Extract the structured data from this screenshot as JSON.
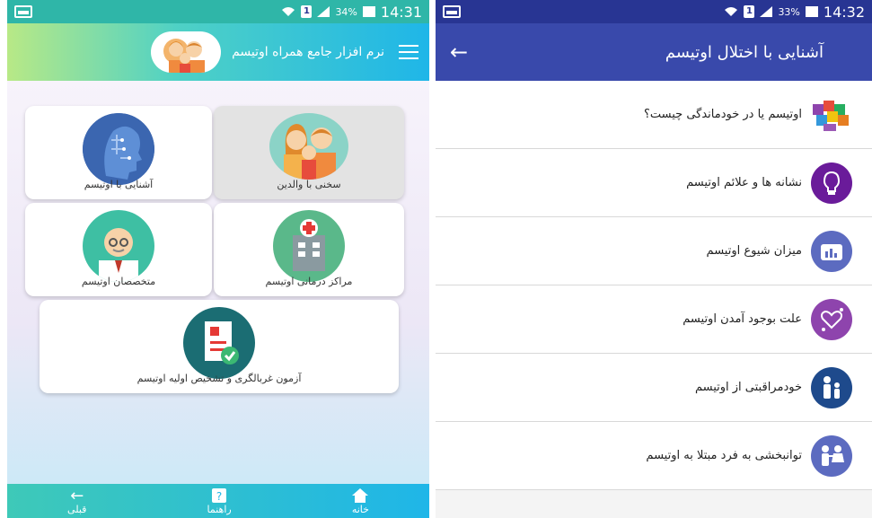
{
  "left": {
    "status": {
      "battery": "34%",
      "time": "14:31",
      "sim": "1"
    },
    "header": {
      "title": "نرم افزار جامع همراه اوتیسم"
    },
    "cards": [
      {
        "label": "سخنی با والدین"
      },
      {
        "label": "آشنایی با اوتیسم"
      },
      {
        "label": "مراکز درمانی اوتیسم"
      },
      {
        "label": "متخصصان اوتیسم"
      },
      {
        "label": "آزمون غربالگری و تشخیص اولیه اوتیسم"
      }
    ],
    "bottom_nav": [
      {
        "label": "خانه",
        "icon": "home-icon"
      },
      {
        "label": "راهنما",
        "icon": "help-icon"
      },
      {
        "label": "قبلی",
        "icon": "arrow-left-icon"
      }
    ]
  },
  "right": {
    "status": {
      "battery": "33%",
      "time": "14:32",
      "sim": "1"
    },
    "header": {
      "title": "آشنایی با اختلال اوتیسم"
    },
    "items": [
      {
        "label": "اوتیسم یا در خودماندگی چیست؟",
        "icon": "puzzle-head-icon"
      },
      {
        "label": "نشانه ها و علائم اوتیسم",
        "icon": "brain-bulb-icon",
        "color": "#6a1b9a"
      },
      {
        "label": "میزان شیوع اوتیسم",
        "icon": "statistics-icon",
        "color": "#5c6bc0"
      },
      {
        "label": "علت بوجود آمدن اوتیسم",
        "icon": "heart-molecule-icon",
        "color": "#8e44ad"
      },
      {
        "label": "خودمراقبتی از اوتیسم",
        "icon": "family-icon",
        "color": "#1e4a8c"
      },
      {
        "label": "توانبخشی به فرد مبتلا به اوتیسم",
        "icon": "children-icon",
        "color": "#5c6bc0"
      }
    ]
  }
}
